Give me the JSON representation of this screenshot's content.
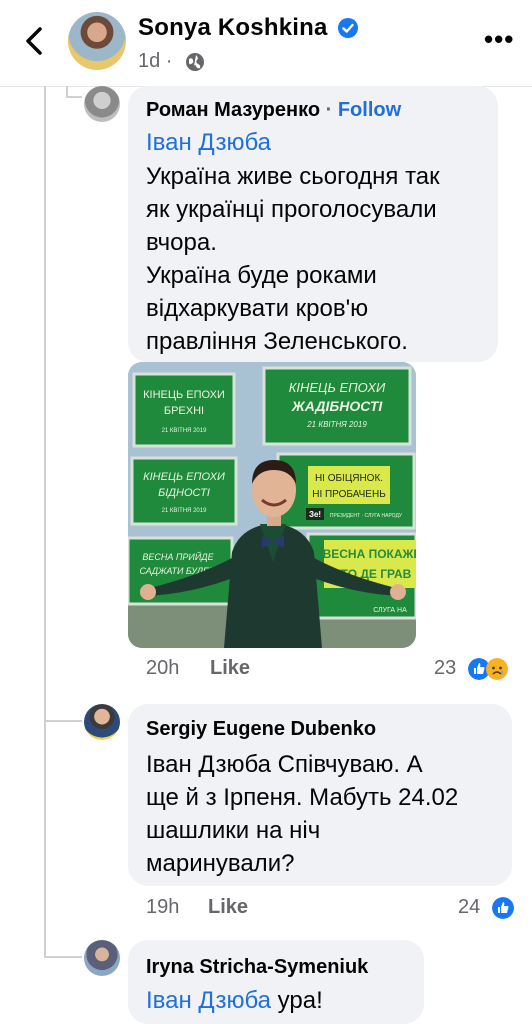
{
  "header": {
    "name": "Sonya Koshkina",
    "meta": "1d ·"
  },
  "comments": [
    {
      "author": "Роман Мазуренко",
      "dot": "·",
      "follow": "Follow",
      "mention": "Іван Дзюба",
      "lines": [
        "Україна живе сьогодня так",
        "як українці проголосували",
        "вчора.",
        "Україна буде роками",
        "відхаркувати кров'ю",
        "правління Зеленського."
      ],
      "time": "20h",
      "like": "Like",
      "reactions": "23"
    },
    {
      "author": "Sergiy Eugene Dubenko",
      "lines": [
        "Іван Дзюба Співчуваю. А",
        "ще й з Ірпеня. Мабуть 24.02",
        "шашлики на ніч",
        "маринували?"
      ],
      "time": "19h",
      "like": "Like",
      "reactions": "24"
    },
    {
      "author": "Iryna Stricha-Symeniuk",
      "mention": "Іван Дзюба",
      "text": " ура!"
    }
  ],
  "poster": {
    "billboards": [
      {
        "line1": "КІНЕЦЬ ЕПОХИ",
        "line2": "БРЕХНІ",
        "date": "21 КВІТНЯ 2019"
      },
      {
        "line1": "КІНЕЦЬ ЕПОХИ",
        "line2": "ЖАДІБНОСТІ",
        "date": "21 КВІТНЯ 2019"
      },
      {
        "line1": "КІНЕЦЬ ЕПОХИ",
        "line2": "БІДНОСТІ",
        "date": "21 КВІТНЯ 2019"
      },
      {
        "line1": "НІ ОБІЦЯНОК.",
        "line2": "НІ ПРОБАЧЕНЬ",
        "date": "ПРЕЗИДЕНТ · СЛУГА НАРОДУ"
      },
      {
        "line1": "ВЕСНА ПРИЙДЕ",
        "line2": "САДЖАТИ БУДЕМ",
        "date": ""
      },
      {
        "line1": "ВЕСНА ПОКАЖЕ",
        "line2": "ХТО ДЕ ГРАВ",
        "date": "СЛУГА НА"
      }
    ],
    "ze": "Зе!"
  },
  "colors": {
    "link": "#216fdb",
    "bubble": "#f0f2f5",
    "billboard": "#1f8a3c"
  }
}
